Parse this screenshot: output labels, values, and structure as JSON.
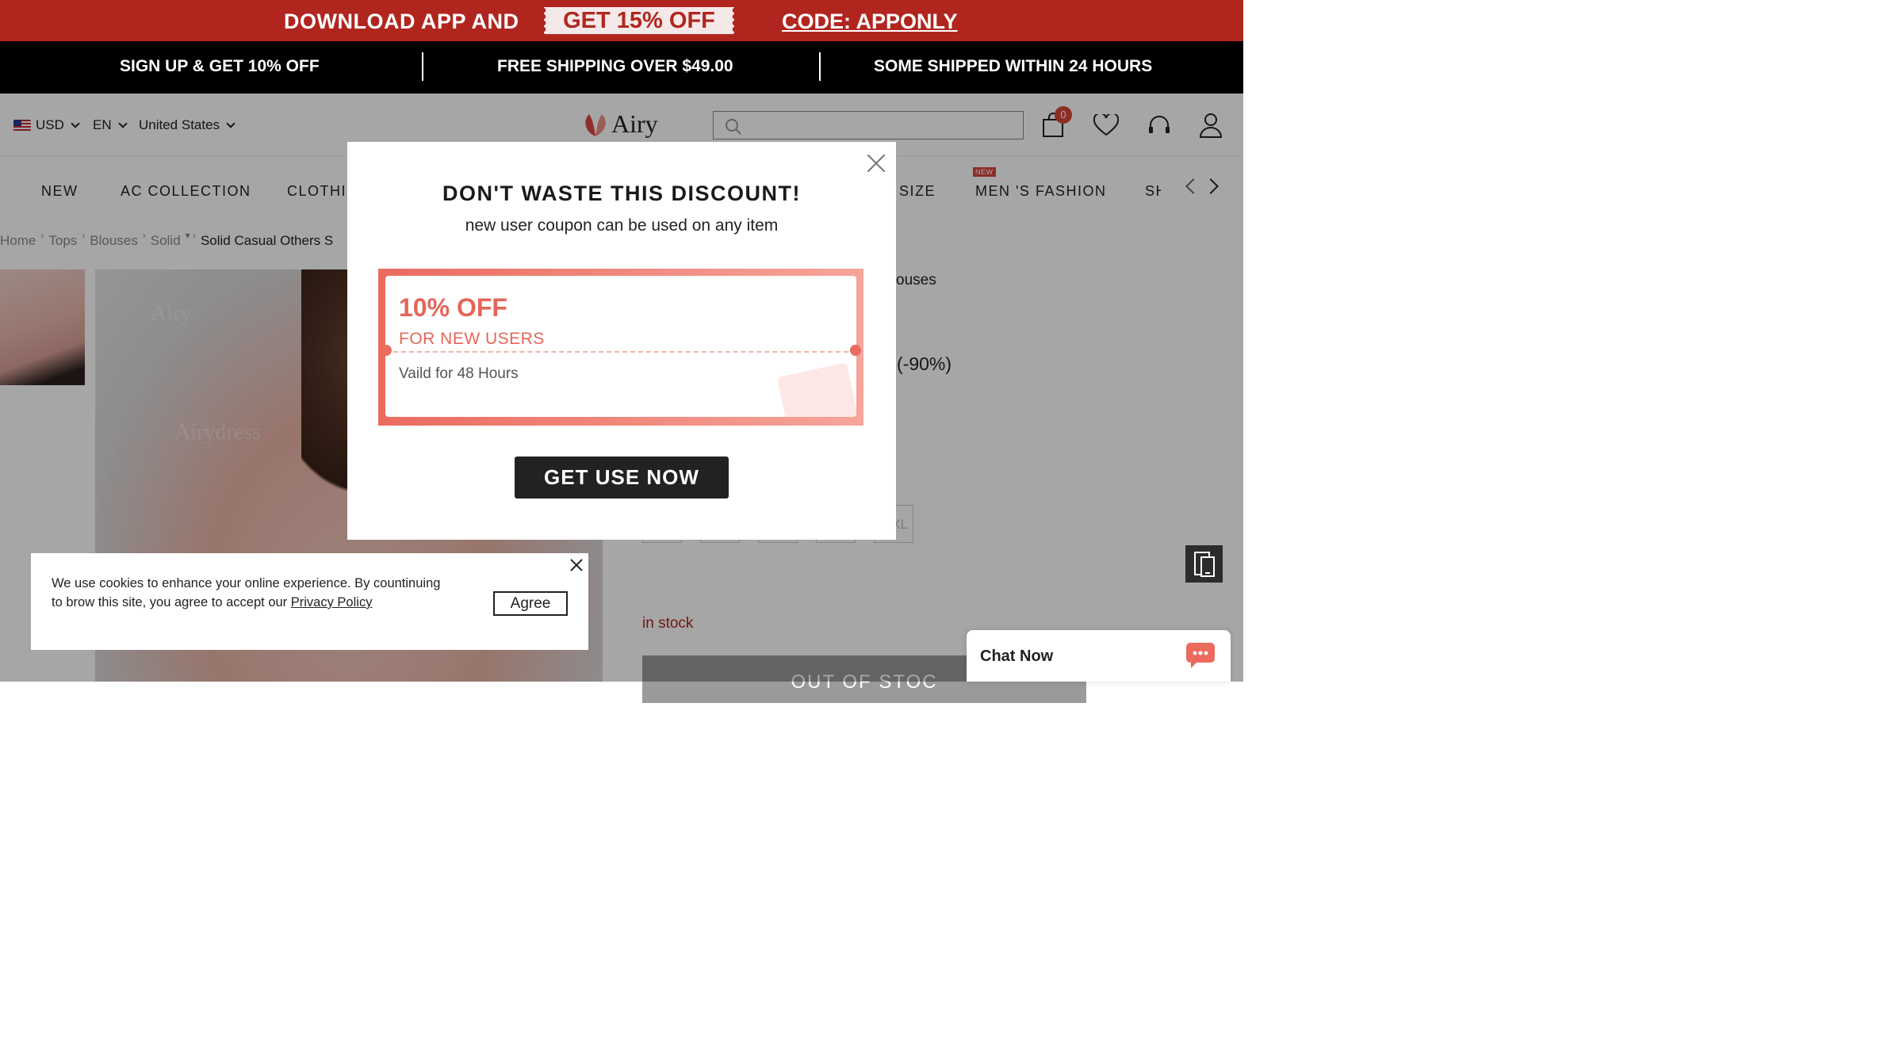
{
  "promo": {
    "left": "DOWNLOAD APP AND",
    "ticket": "GET 15% OFF",
    "code": "CODE: APPONLY"
  },
  "benefits": [
    "SIGN UP & GET 10% OFF",
    "FREE SHIPPING OVER $49.00",
    "SOME SHIPPED WITHIN 24 HOURS"
  ],
  "header": {
    "currency": "USD",
    "language": "EN",
    "country": "United States",
    "logo": "Airy",
    "cart_count": "0",
    "search_placeholder": ""
  },
  "nav": {
    "items": [
      "NEW",
      "AC COLLECTION",
      "CLOTHI",
      "SIZE",
      "MEN 'S FASHION",
      "SH"
    ],
    "new_tag": "NEW"
  },
  "breadcrumb": [
    "Home",
    "Tops",
    "Blouses",
    "Solid",
    "Solid Casual Others S"
  ],
  "product": {
    "watermark_1": "Airy",
    "watermark_2": "Airydress",
    "title_fragment": "ouses",
    "discount": "(-90%)",
    "size_fragment": "XL",
    "stock": "in stock",
    "out_of_stock": "OUT OF STOC"
  },
  "modal": {
    "title": "DON'T WASTE THIS DISCOUNT!",
    "subtitle": "new user coupon can be used on any item",
    "coupon_amount": "10% OFF",
    "coupon_sub": "FOR NEW USERS",
    "coupon_valid": "Vaild for 48 Hours",
    "button": "GET USE NOW"
  },
  "cookie": {
    "text": "We use cookies to enhance your online experience. By countinuing to brow this site, you agree to accept our ",
    "link": "Privacy Policy",
    "agree": "Agree"
  },
  "chat": {
    "label": "Chat Now"
  },
  "colors": {
    "brand_red": "#b0261f",
    "coupon_coral": "#e4665a",
    "dark": "#222222"
  }
}
